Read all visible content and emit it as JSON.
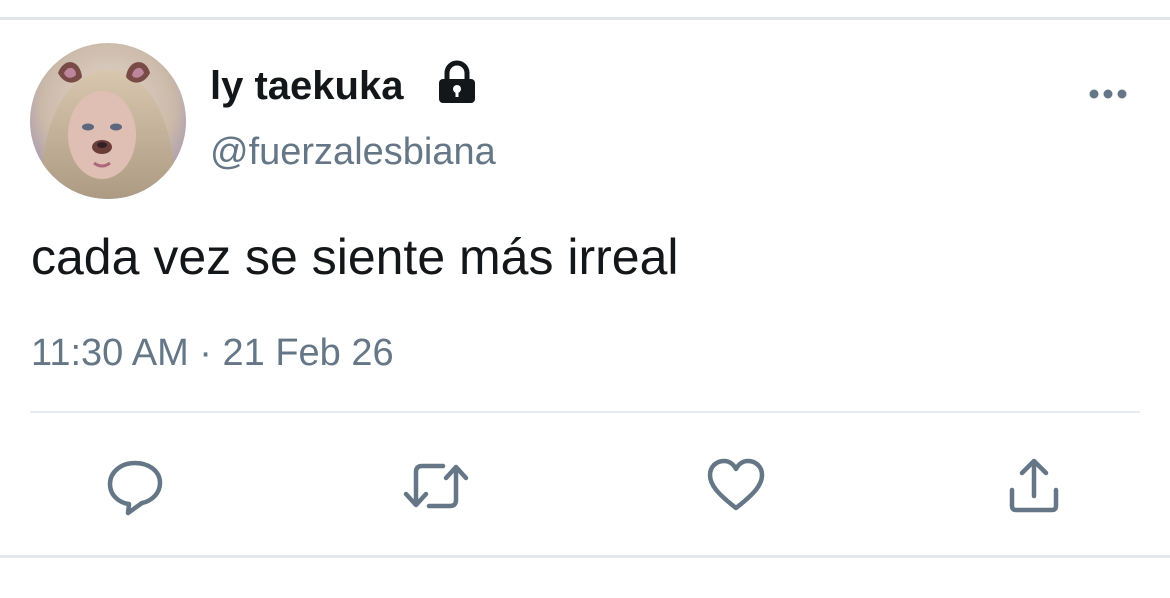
{
  "tweet": {
    "author": {
      "display_name": "ly taekuka",
      "handle": "@fuerzalesbiana",
      "protected_icon": "lock-icon",
      "avatar_icon": "avatar"
    },
    "text": "cada vez se siente más irreal",
    "timestamp": "11:30 AM · 21 Feb 26",
    "menu_icon": "more-icon",
    "actions": [
      {
        "name": "reply",
        "icon": "reply-icon"
      },
      {
        "name": "retweet",
        "icon": "retweet-icon"
      },
      {
        "name": "like",
        "icon": "heart-icon"
      },
      {
        "name": "share",
        "icon": "share-icon"
      }
    ]
  },
  "colors": {
    "primary_text": "#14171a",
    "secondary_text": "#657786",
    "icon_gray": "#657786",
    "divider": "#e6ecf0"
  }
}
